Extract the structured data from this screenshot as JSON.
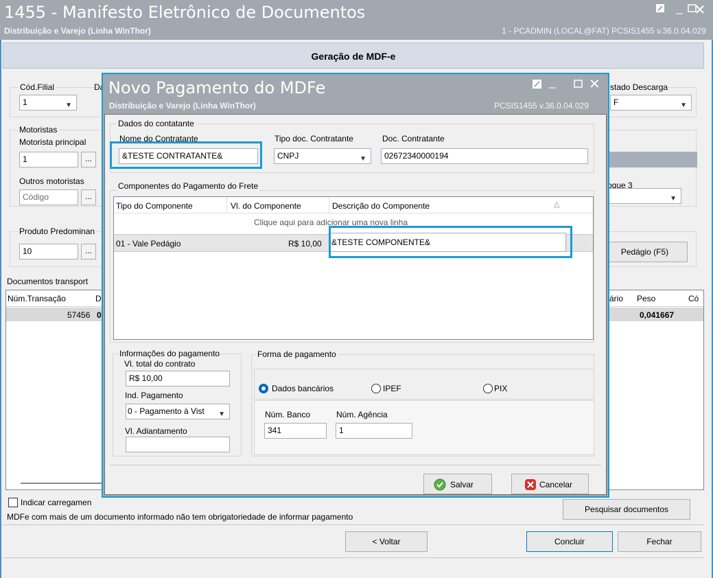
{
  "window": {
    "title": "1455 - Manifesto Eletrônico de Documentos",
    "subtitle": "Distribuição e Varejo (Linha WinThor)",
    "right_info": "1 - PCADMIN (LOCAL@FAT)  PCSIS1455  v.36.0.04.029"
  },
  "heading": "Geração de MDF-e",
  "form": {
    "cod_filial_label": "Cód.Filial",
    "cod_filial_value": "1",
    "da_label": "Da",
    "estado_descarga_label": "stado Descarga",
    "estado_descarga_value": "F",
    "motoristas_group": "Motoristas",
    "motorista_principal_label": "Motorista principal",
    "motorista_principal_value": "1",
    "outros_motoristas_label": "Outros motoristas",
    "outros_motoristas_placeholder": "Código",
    "bloque_label": "oque 3",
    "produto_label": "Produto Predominan",
    "produto_value": "10",
    "pedagio_button": "Pedágio (F5)",
    "ellipsis": "...",
    "documentos_group": "Documentos transport",
    "grid_headers": {
      "num_transacao": "Núm.Transação",
      "d": "D",
      "ario": "ário",
      "peso": "Peso",
      "co": "Có"
    },
    "grid_row": {
      "num_transacao": "57456",
      "d": "0",
      "peso": "0,041667"
    },
    "indicar_checkbox": "Indicar carregamen",
    "pesquisar_button": "Pesquisar documentos",
    "info_text": "MDFe com mais de um documento informado não tem obrigatoriedade de informar pagamento",
    "voltar_button": "< Voltar",
    "concluir_button": "Concluir",
    "fechar_button": "Fechar"
  },
  "dialog": {
    "title": "Novo Pagamento do MDFe",
    "subtitle": "Distribuição e Varejo (Linha WinThor)",
    "version": "PCSIS1455  v.36.0.04.029",
    "contratante_group": "Dados do contatante",
    "nome_label": "Nome do Contratante",
    "nome_value": "&TESTE CONTRATANTE&",
    "tipo_doc_label": "Tipo doc. Contratante",
    "tipo_doc_value": "CNPJ",
    "doc_label": "Doc. Contratante",
    "doc_value": "02672340000194",
    "componentes_group": "Componentes do Pagamento do Frete",
    "grid_headers": [
      "Tipo do Componente",
      "Vl. do Componente",
      "Descrição do Componente"
    ],
    "add_row_hint": "Clique aqui para adicionar uma nova linha",
    "rows": [
      {
        "tipo": "01 - Vale Pedágio",
        "valor": "R$ 10,00",
        "descricao": "&TESTE COMPONENTE&"
      }
    ],
    "info_pag_group": "Informações do pagamento",
    "vl_total_label": "Vl. total do contrato",
    "vl_total_value": "R$ 10,00",
    "ind_pag_label": "Ind. Pagamento",
    "ind_pag_value": "0 - Pagamento à Vist",
    "vl_adiant_label": "Vl. Adiantamento",
    "forma_group": "Forma de pagamento",
    "radio_dados": "Dados bancários",
    "radio_ipef": "IPEF",
    "radio_pix": "PIX",
    "num_banco_label": "Núm. Banco",
    "num_banco_value": "341",
    "num_agencia_label": "Núm. Agência",
    "num_agencia_value": "1",
    "salvar_button": "Salvar",
    "cancelar_button": "Cancelar"
  },
  "colors": {
    "accent": "#1a9ad6",
    "titlebar": "#a2a8b0",
    "selected_row": "#d9d9d9"
  }
}
